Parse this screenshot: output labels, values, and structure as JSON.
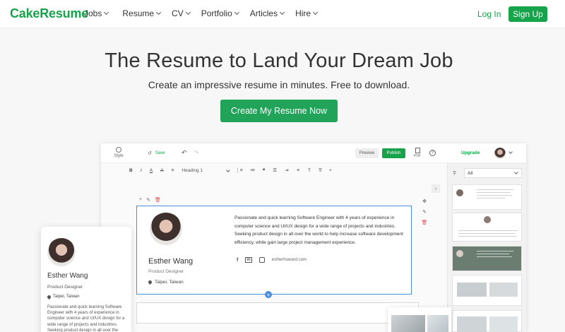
{
  "nav": {
    "logo": "CakeResume",
    "menu": [
      "Jobs",
      "Resume",
      "CV",
      "Portfolio",
      "Articles",
      "Hire"
    ],
    "login": "Log In",
    "signup": "Sign Up"
  },
  "hero": {
    "title": "The Resume to Land Your Dream Job",
    "subtitle": "Create an impressive resume in minutes. Free to download.",
    "cta": "Create My Resume Now"
  },
  "editor": {
    "style_label": "Style",
    "save_label": "Save",
    "preview_label": "Preview",
    "publish_label": "Publish",
    "pdf_label": "PDF",
    "upgrade_label": "Upgrade",
    "heading_select": "Heading 1",
    "template_filter": "All",
    "accent_color": "#16a34a"
  },
  "resume": {
    "name": "Esther Wang",
    "role": "Product Designer",
    "location": "Taipei, Taiwan",
    "bio": "Passionate and quick learning Software Engineer with 4 years of experience in computer science and UI/UX design for a wide range of projects and industries. Seeking product design in all over the world to help increase software development efficiency, while gain large project management experience.",
    "website": "estherhoward.com"
  },
  "profile_card": {
    "name": "Esther Wang",
    "role": "Product Designer",
    "location": "Taipei, Taiwan",
    "bio": "Passionate and quick learning Software Engineer with 4 years of experience in computer science and UI/UX design for a wide range of projects and industries. Seeking product design in all over the world"
  }
}
